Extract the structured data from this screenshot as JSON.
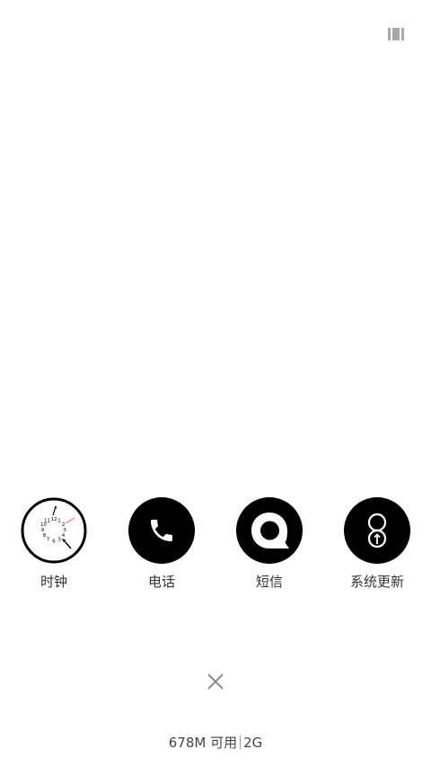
{
  "header": {
    "menu_icon": "multitask-view-icon"
  },
  "apps": [
    {
      "label": "时钟",
      "icon": "clock-icon"
    },
    {
      "label": "电话",
      "icon": "phone-icon"
    },
    {
      "label": "短信",
      "icon": "message-icon"
    },
    {
      "label": "系统更新",
      "icon": "system-update-icon"
    }
  ],
  "clock": {
    "numbers": [
      "12",
      "1",
      "2",
      "3",
      "4",
      "5",
      "6",
      "7",
      "8",
      "9",
      "10",
      "11"
    ]
  },
  "footer": {
    "close_icon": "close-icon",
    "memory_available": "678M 可用",
    "memory_total": "2G"
  },
  "colors": {
    "icon_bg": "#000000",
    "text": "#333333",
    "clock_second_hand": "#e8603c",
    "menu_icon": "#a9a9a9",
    "close_icon": "#8a8a8a"
  }
}
